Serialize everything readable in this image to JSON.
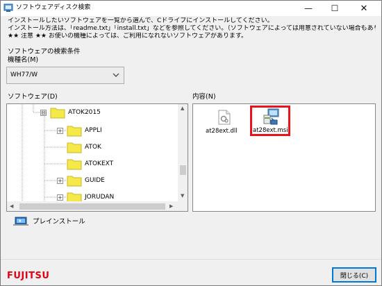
{
  "window": {
    "title": "ソフトウェアディスク検索",
    "minimize_glyph": "—",
    "maximize_glyph": "☐",
    "close_glyph": "✕"
  },
  "instructions": [
    "インストールしたいソフトウェアを一覧から選んで、Cドライブにインストールしてください。",
    "インストール方法は、「readme.txt」「install.txt」などを参照してください。（ソフトウェアによっては用意されていない場合もあります）",
    "★★ 注意 ★★ お使いの機種によっては、ご利用になれないソフトウェアがあります。"
  ],
  "search": {
    "conditions_label": "ソフトウェアの検索条件",
    "model_label": "機種名(M)",
    "model_value": "WH77/W"
  },
  "software_label": "ソフトウェア(D)",
  "content_label": "内容(N)",
  "tree": {
    "items": [
      {
        "label": "ATOK2015",
        "expander": "⊟"
      },
      {
        "label": "APPLI",
        "expander": "+"
      },
      {
        "label": "ATOK",
        "expander": ""
      },
      {
        "label": "ATOKEXT",
        "expander": ""
      },
      {
        "label": "GUIDE",
        "expander": "+"
      },
      {
        "label": "JORUDAN",
        "expander": "+"
      }
    ]
  },
  "files": [
    {
      "name": "at28ext.dll",
      "icon": "dll-file-icon"
    },
    {
      "name": "at28ext.msi",
      "icon": "msi-installer-icon"
    }
  ],
  "preinstall_label": "プレインストール",
  "brand": "FUJITSU",
  "close_button": "閉じる(C)",
  "colors": {
    "highlight": "#e8141c",
    "folder": "#f5e94a",
    "brand": "#e60012",
    "focus": "#0078d7"
  }
}
